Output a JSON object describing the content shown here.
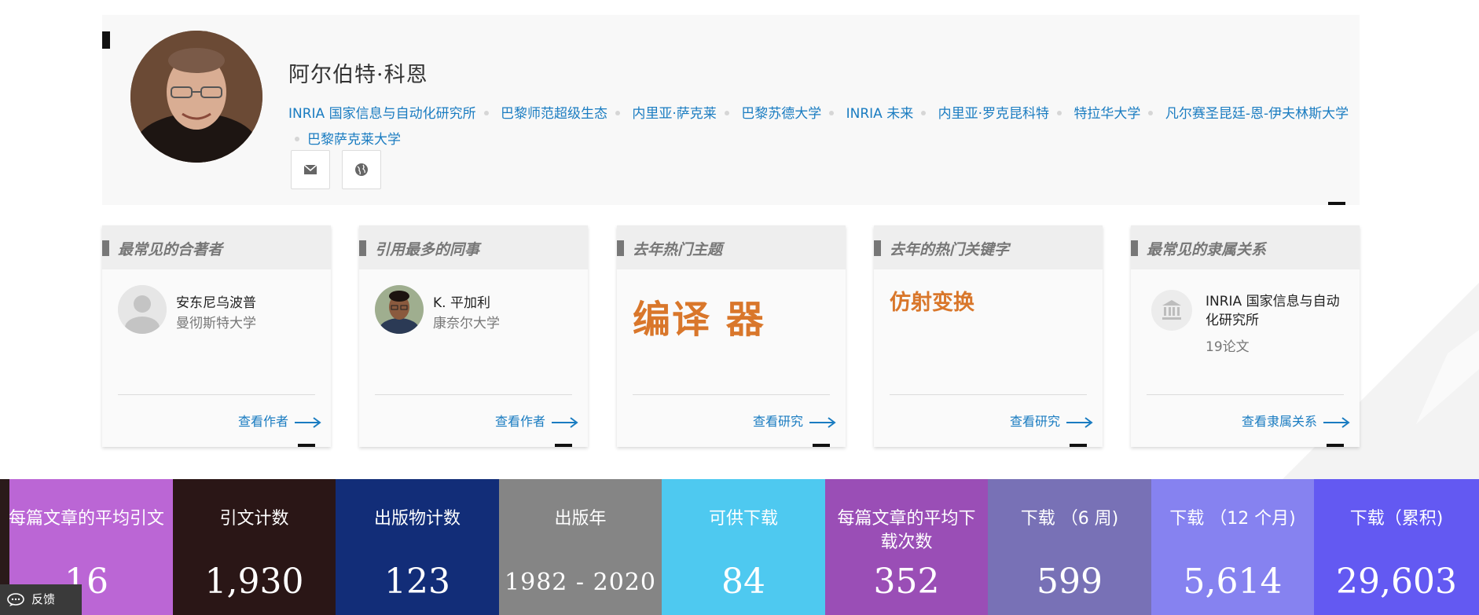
{
  "profile": {
    "name": "阿尔伯特·科恩",
    "affiliations": [
      "INRIA 国家信息与自动化研究所",
      "巴黎师范超级生态",
      "内里亚·萨克莱",
      "巴黎苏德大学",
      "INRIA 未来",
      "内里亚·罗克昆科特",
      "特拉华大学",
      "凡尔赛圣昆廷-恩-伊夫林斯大学",
      "巴黎萨克莱大学"
    ],
    "contact_icons": [
      "mail-icon",
      "globe-icon"
    ]
  },
  "cards": {
    "coauthor": {
      "title": "最常见的合著者",
      "name": "安东尼乌波普",
      "affiliation": "曼彻斯特大学",
      "link": "查看作者"
    },
    "colleague": {
      "title": "引用最多的同事",
      "name": "K. 平加利",
      "affiliation": "康奈尔大学",
      "link": "查看作者"
    },
    "topic": {
      "title": "去年热门主题",
      "value": "编译 器",
      "link": "查看研究"
    },
    "keyword": {
      "title": "去年的热门关键字",
      "value": "仿射变换",
      "link": "查看研究"
    },
    "affiliation": {
      "title": "最常见的隶属关系",
      "name": "INRIA 国家信息与自动化研究所",
      "count": "19论文",
      "link": "查看隶属关系"
    }
  },
  "stats": [
    {
      "label": "每篇文章的平均引文",
      "value": "16",
      "color": "#bb66d5"
    },
    {
      "label": "引文计数",
      "value": "1,930",
      "color": "#2a1616"
    },
    {
      "label": "出版物计数",
      "value": "123",
      "color": "#122d78"
    },
    {
      "label": "出版年",
      "value": "1982 - 2020",
      "color": "#858585"
    },
    {
      "label": "可供下载",
      "value": "84",
      "color": "#4ec9f0"
    },
    {
      "label": "每篇文章的平均下载次数",
      "value": "352",
      "color": "#9a4eb6"
    },
    {
      "label": "下载 （6 周)",
      "value": "599",
      "color": "#7871b6"
    },
    {
      "label": "下载 （12 个月)",
      "value": "5,614",
      "color": "#8682f0"
    },
    {
      "label": "下载（累积)",
      "value": "29,603",
      "color": "#6359f2"
    }
  ],
  "feedback": "反馈",
  "colors": {
    "link": "#1a7cc1",
    "accent": "#d9772b"
  }
}
